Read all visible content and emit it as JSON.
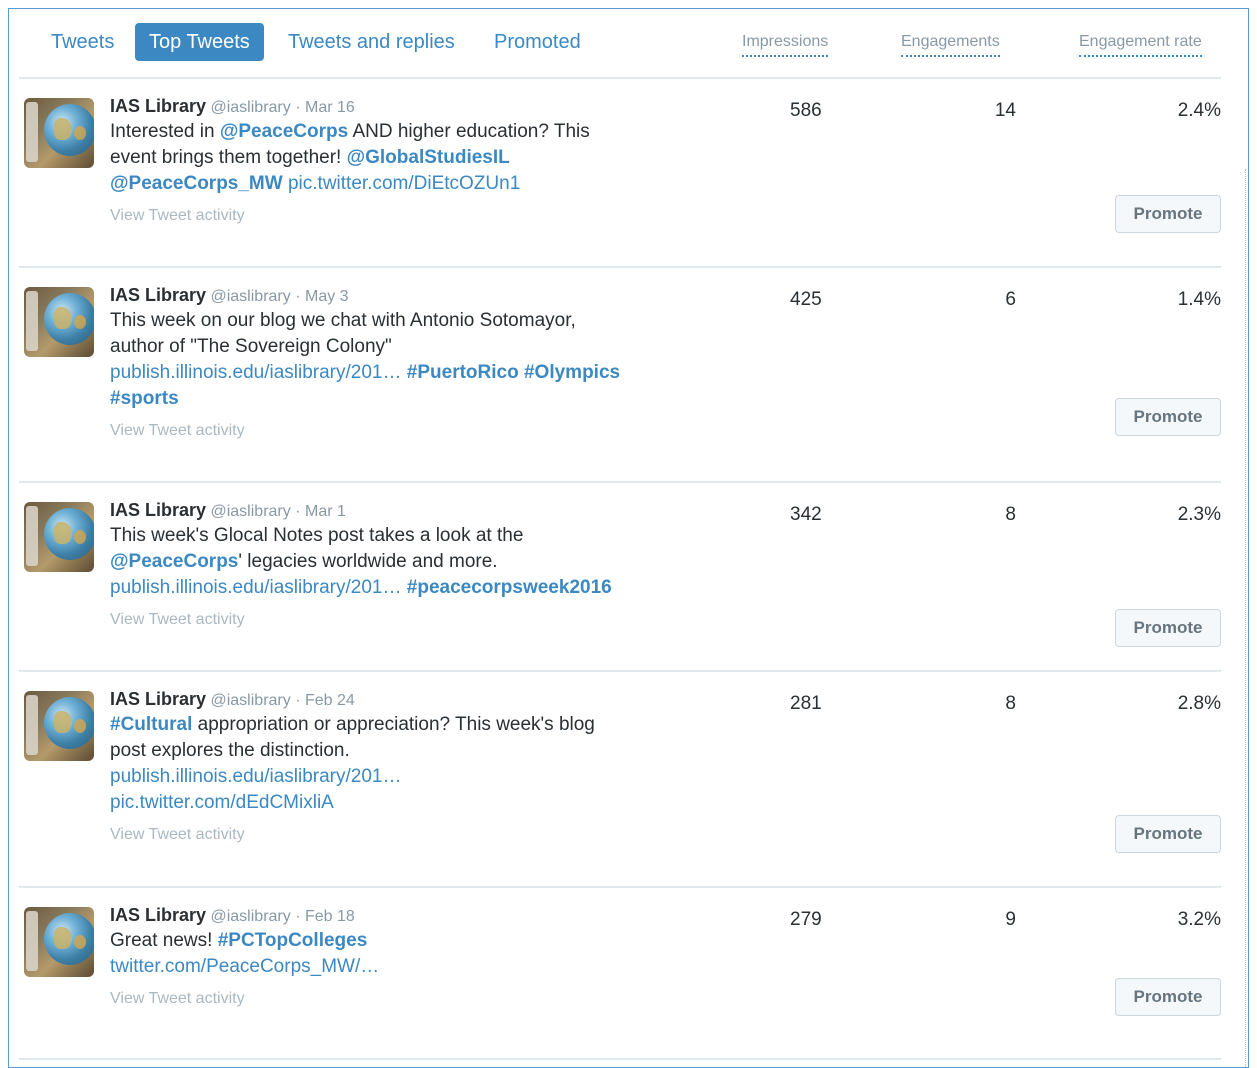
{
  "tabs": [
    "Tweets",
    "Top Tweets",
    "Tweets and replies",
    "Promoted"
  ],
  "active_tab": "Top Tweets",
  "columns": {
    "impressions": "Impressions",
    "engagements": "Engagements",
    "engagement_rate": "Engagement rate"
  },
  "promote_label": "Promote",
  "activity_label": "View Tweet activity",
  "author": {
    "name": "IAS Library",
    "handle": "@iaslibrary"
  },
  "tweets": [
    {
      "date": "Mar 16",
      "impressions": "586",
      "engagements": "14",
      "rate": "2.4%",
      "lines": [
        [
          {
            "t": "Interested in ",
            "k": "text"
          },
          {
            "t": "@PeaceCorps",
            "k": "mention"
          },
          {
            "t": " AND higher education? This",
            "k": "text"
          }
        ],
        [
          {
            "t": "event brings them together! ",
            "k": "text"
          },
          {
            "t": "@GlobalStudiesIL",
            "k": "mention"
          }
        ],
        [
          {
            "t": "@PeaceCorps_MW",
            "k": "mention"
          },
          {
            "t": " pic.twitter.com/DiEtcOZUn1",
            "k": "link"
          }
        ]
      ]
    },
    {
      "date": "May 3",
      "impressions": "425",
      "engagements": "6",
      "rate": "1.4%",
      "lines": [
        [
          {
            "t": "This week on our blog we chat with Antonio Sotomayor,",
            "k": "text"
          }
        ],
        [
          {
            "t": "author of \"The Sovereign Colony\"",
            "k": "text"
          }
        ],
        [
          {
            "t": "publish.illinois.edu/iaslibrary/201…",
            "k": "link"
          },
          {
            "t": " #PuertoRico",
            "k": "mention"
          },
          {
            "t": " #Olympics",
            "k": "mention"
          }
        ],
        [
          {
            "t": "#sports",
            "k": "mention"
          }
        ]
      ]
    },
    {
      "date": "Mar 1",
      "impressions": "342",
      "engagements": "8",
      "rate": "2.3%",
      "lines": [
        [
          {
            "t": "This week's Glocal Notes post takes a look at the",
            "k": "text"
          }
        ],
        [
          {
            "t": "@PeaceCorps",
            "k": "mention"
          },
          {
            "t": "' legacies worldwide and more.",
            "k": "text"
          }
        ],
        [
          {
            "t": "publish.illinois.edu/iaslibrary/201…",
            "k": "link"
          },
          {
            "t": " #peacecorpsweek2016",
            "k": "mention"
          }
        ]
      ]
    },
    {
      "date": "Feb 24",
      "impressions": "281",
      "engagements": "8",
      "rate": "2.8%",
      "lines": [
        [
          {
            "t": "#Cultural",
            "k": "mention"
          },
          {
            "t": " appropriation or appreciation? This week's blog",
            "k": "text"
          }
        ],
        [
          {
            "t": "post explores the distinction.",
            "k": "text"
          }
        ],
        [
          {
            "t": "publish.illinois.edu/iaslibrary/201…",
            "k": "link"
          }
        ],
        [
          {
            "t": "pic.twitter.com/dEdCMixliA",
            "k": "link"
          }
        ]
      ]
    },
    {
      "date": "Feb 18",
      "impressions": "279",
      "engagements": "9",
      "rate": "3.2%",
      "lines": [
        [
          {
            "t": "Great news! ",
            "k": "text"
          },
          {
            "t": "#PCTopColleges",
            "k": "mention"
          }
        ],
        [
          {
            "t": "twitter.com/PeaceCorps_MW/…",
            "k": "link"
          }
        ]
      ]
    }
  ]
}
